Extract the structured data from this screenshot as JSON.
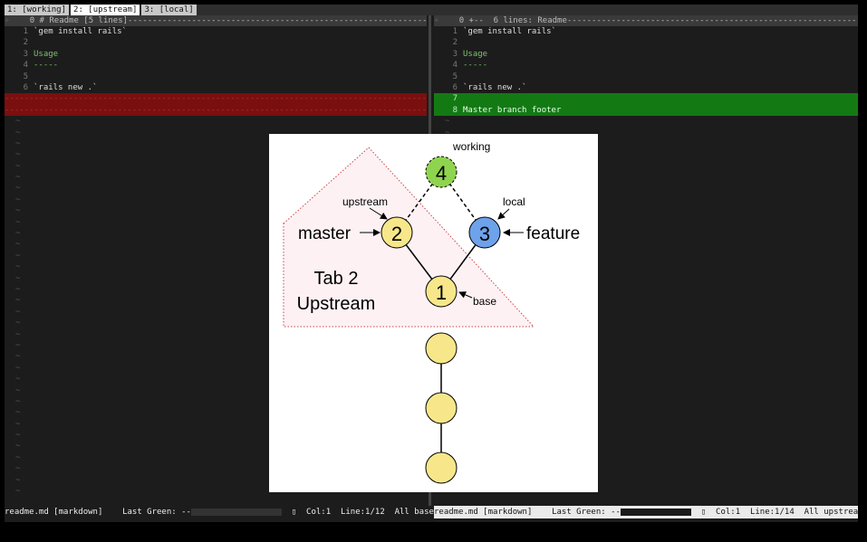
{
  "tabs": [
    {
      "label": "1: [working]"
    },
    {
      "label": "2: [upstream]"
    },
    {
      "label": "3: [local]"
    }
  ],
  "left_pane": {
    "fold_text": "0 # Readme [5 lines]-------------------------------------------------------------------",
    "lines": [
      {
        "num": "1",
        "text": "`gem install rails`"
      },
      {
        "num": "2",
        "text": ""
      },
      {
        "num": "3",
        "text": "Usage"
      },
      {
        "num": "4",
        "text": "-----"
      },
      {
        "num": "5",
        "text": ""
      },
      {
        "num": "6",
        "text": "`rails new .`"
      }
    ],
    "deleted_fill": "-------------------------------------------------------------------------------------------"
  },
  "right_pane": {
    "fold_text": "0 +--  6 lines: Readme--------------------------------------------------------------------",
    "lines": [
      {
        "num": "1",
        "text": "`gem install rails`"
      },
      {
        "num": "2",
        "text": ""
      },
      {
        "num": "3",
        "text": "Usage"
      },
      {
        "num": "4",
        "text": "-----"
      },
      {
        "num": "5",
        "text": ""
      },
      {
        "num": "6",
        "text": "`rails new .`"
      },
      {
        "num": "7",
        "text": ""
      },
      {
        "num": "8",
        "text": "Master branch footer"
      }
    ]
  },
  "status_left": {
    "file": "readme.md [markdown]",
    "last_green": "Last Green: --",
    "col": "Col:1",
    "line": "Line:1/12",
    "mode": "All base"
  },
  "status_right": {
    "file": "readme.md [markdown]",
    "last_green": "Last Green: --",
    "col": "Col:1",
    "line": "Line:1/14",
    "mode": "All upstream"
  },
  "diagram": {
    "node_working": "4",
    "label_working": "working",
    "node_master": "2",
    "label_upstream": "upstream",
    "label_master": "master",
    "node_feature": "3",
    "label_local": "local",
    "label_feature": "feature",
    "node_base": "1",
    "label_base": "base",
    "tab_title_1": "Tab 2",
    "tab_title_2": "Upstream",
    "colors": {
      "yellow": "#f7e78a",
      "green": "#8fd44f",
      "blue": "#6ea2ea",
      "region": "#fdf1f4"
    }
  }
}
